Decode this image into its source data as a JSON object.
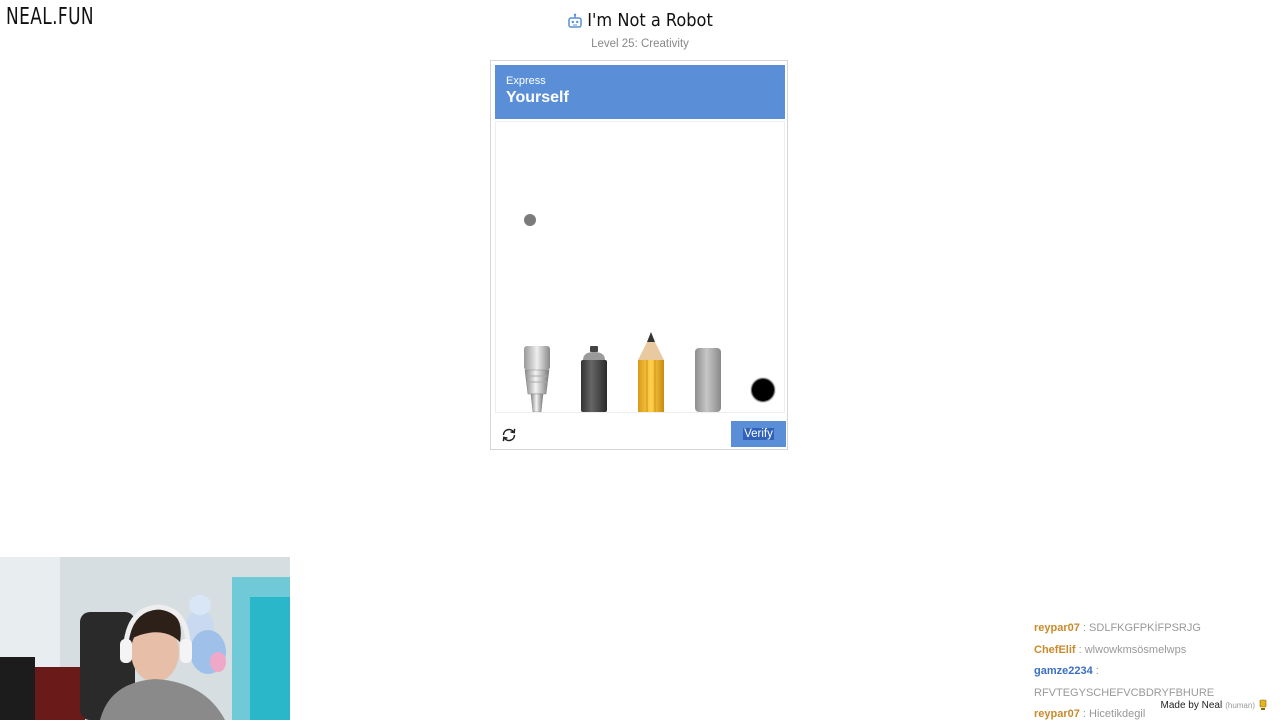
{
  "site": {
    "logo": "NEAL.FUN"
  },
  "header": {
    "title": "I'm Not a Robot",
    "subtitle": "Level 25: Creativity"
  },
  "captcha": {
    "prompt_small": "Express",
    "prompt_big": "Yourself",
    "tools": [
      "paintbrush",
      "spray-can",
      "pencil",
      "eraser"
    ],
    "selected_color": "#000000",
    "verify_label": "Verify"
  },
  "colors": {
    "accent": "#5a8fd8",
    "verify_highlight": "#2f62b8"
  },
  "chat": [
    {
      "user": "reypar07",
      "text": "SDLFKGFPKİFPSRJG",
      "color": "#c88a2a"
    },
    {
      "user": "ChefElif",
      "text": "wlwowkmsösmelwps",
      "color": "#c88a2a"
    },
    {
      "user": "gamze2234",
      "text": "RFVTEGYSCHEFVCBDRYFBHURE",
      "color": "#3b6fc2"
    },
    {
      "user": "reypar07",
      "text": "Hicetikdegil",
      "color": "#c88a2a"
    }
  ],
  "footer": {
    "made_by": "Made by Neal",
    "human": "(human)"
  }
}
